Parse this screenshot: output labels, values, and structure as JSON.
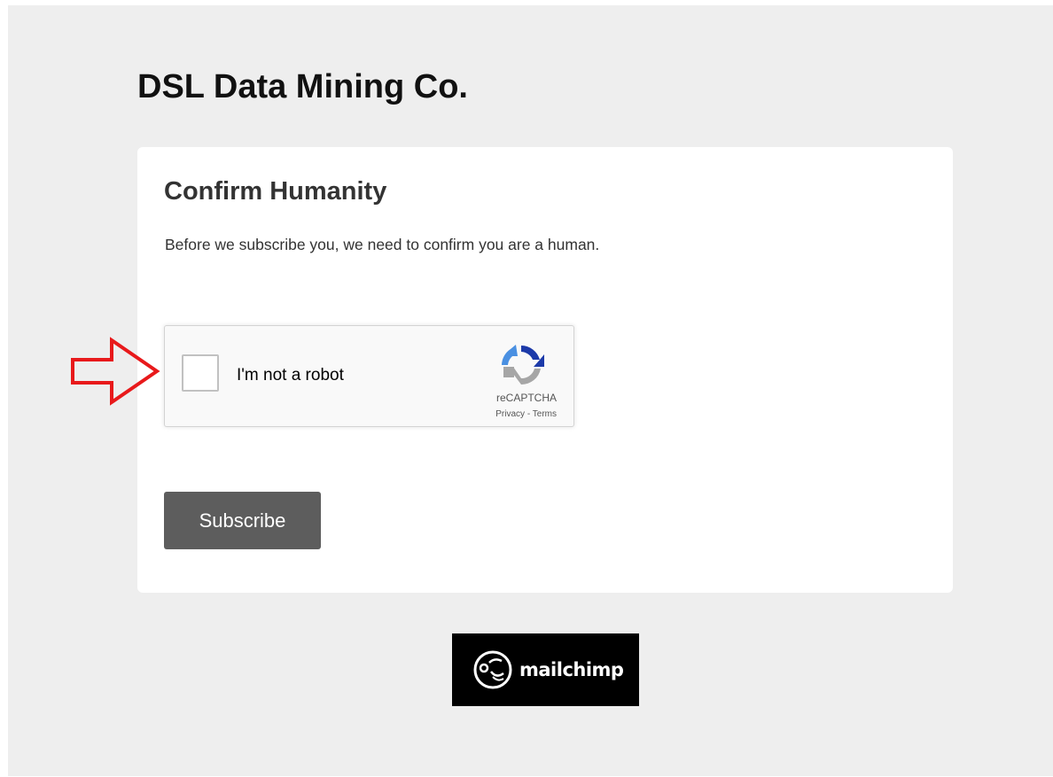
{
  "page": {
    "org_name": "DSL Data Mining Co."
  },
  "card": {
    "title": "Confirm Humanity",
    "description": "Before we subscribe you, we need to confirm you are a human."
  },
  "recaptcha": {
    "checkbox_label": "I'm not a robot",
    "checked": false,
    "brand": "reCAPTCHA",
    "privacy_link": "Privacy",
    "separator": " - ",
    "terms_link": "Terms"
  },
  "subscribe": {
    "label": "Subscribe"
  },
  "footer": {
    "badge_text": "mailchimp"
  },
  "icons": {
    "recaptcha_logo": "recaptcha-logo-icon",
    "mailchimp_logo": "mailchimp-freddie-icon",
    "annotation_arrow": "red-arrow-right-icon"
  },
  "colors": {
    "page_background": "#eeeeee",
    "card_background": "#ffffff",
    "button_background": "#5d5d5d",
    "arrow": "#e8191b",
    "badge_background": "#000000"
  }
}
